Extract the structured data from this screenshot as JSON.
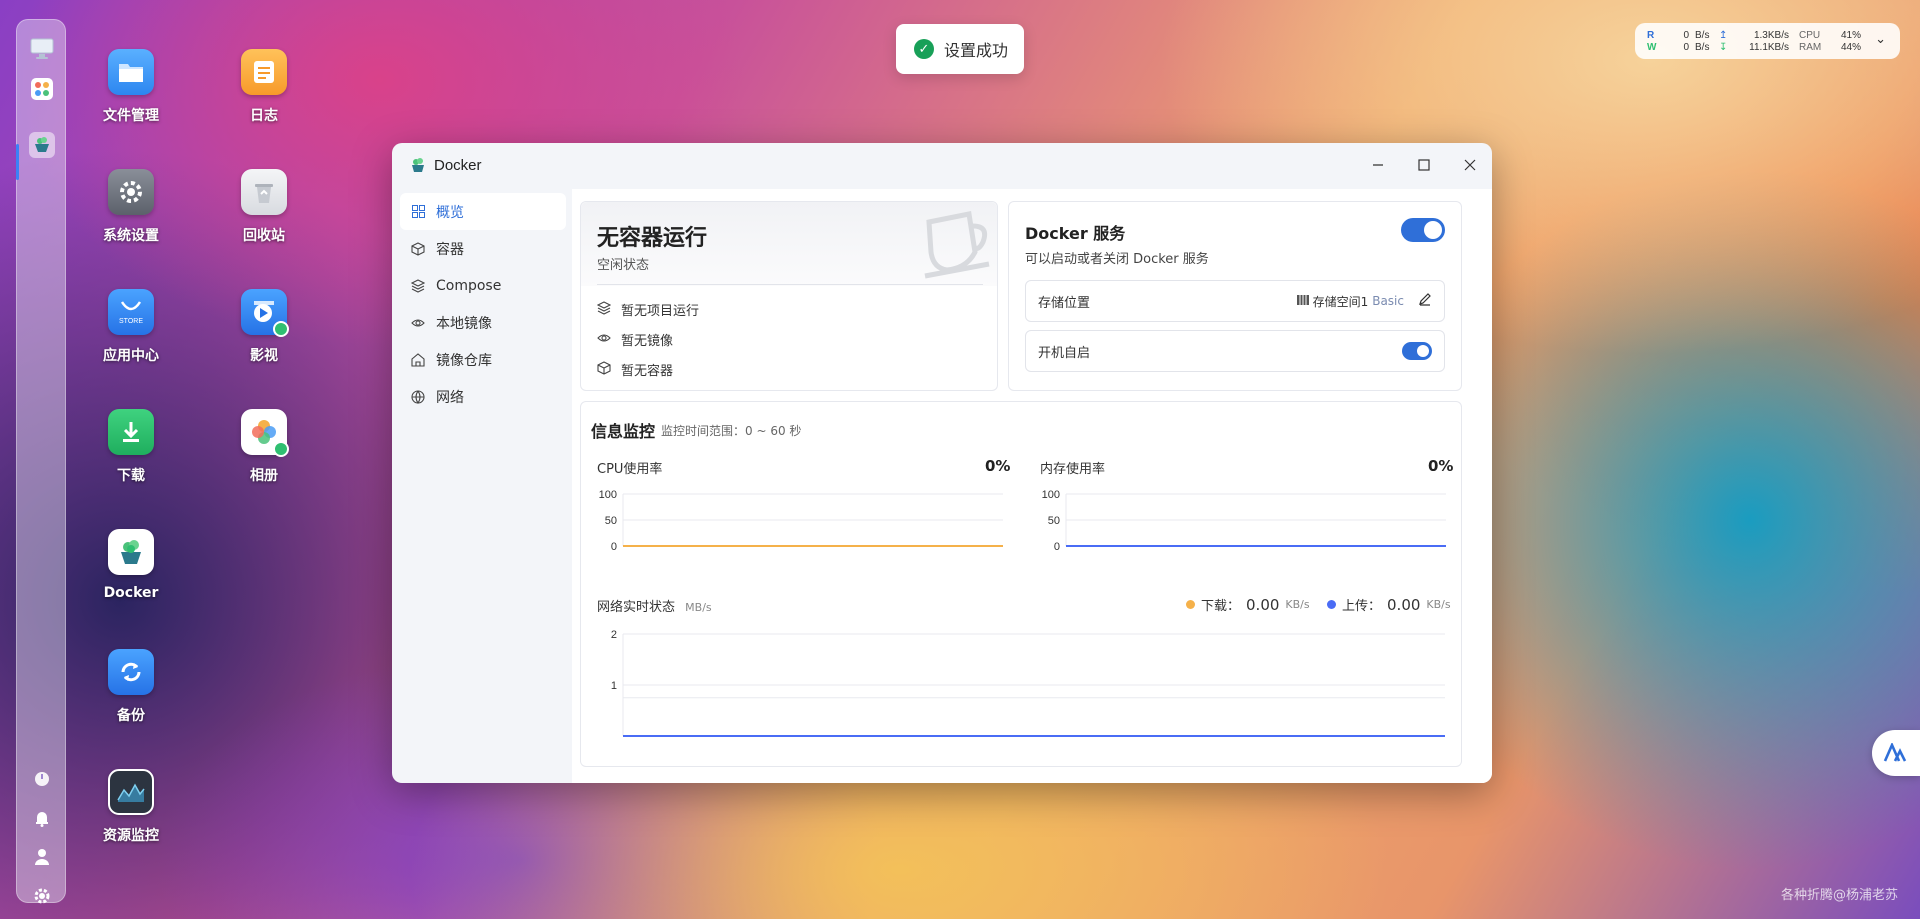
{
  "toast": {
    "text": "设置成功"
  },
  "net_widget": {
    "read_label": "R",
    "write_label": "W",
    "read_value": "0",
    "write_value": "0",
    "read_unit": "B/s",
    "write_unit": "B/s",
    "upload_speed": "1.3KB/s",
    "download_speed": "11.1KB/s",
    "cpu_label": "CPU",
    "ram_label": "RAM",
    "cpu_value": "41%",
    "ram_value": "44%"
  },
  "desktop_icons": [
    {
      "label": "文件管理"
    },
    {
      "label": "日志"
    },
    {
      "label": "系统设置"
    },
    {
      "label": "回收站"
    },
    {
      "label": "应用中心"
    },
    {
      "label": "影视"
    },
    {
      "label": "下载"
    },
    {
      "label": "相册"
    },
    {
      "label": "Docker"
    },
    {
      "label": "备份"
    },
    {
      "label": "资源监控"
    }
  ],
  "store_badge": "STORE",
  "window": {
    "title": "Docker",
    "nav": [
      {
        "label": "概览",
        "icon": "grid-icon",
        "active": true
      },
      {
        "label": "容器",
        "icon": "cube-icon"
      },
      {
        "label": "Compose",
        "icon": "layers-icon"
      },
      {
        "label": "本地镜像",
        "icon": "eye-icon"
      },
      {
        "label": "镜像仓库",
        "icon": "house-icon"
      },
      {
        "label": "网络",
        "icon": "globe-icon"
      }
    ],
    "idle": {
      "title": "无容器运行",
      "subtitle": "空闲状态",
      "items": [
        "暂无项目运行",
        "暂无镜像",
        "暂无容器"
      ]
    },
    "service": {
      "title": "Docker 服务",
      "subtitle": "可以启动或者关闭 Docker 服务",
      "enabled": true,
      "storage_label": "存储位置",
      "storage_value": "存储空间1",
      "storage_tag": "Basic",
      "autostart_label": "开机自启",
      "autostart": true
    },
    "monitor": {
      "title": "信息监控",
      "range": "监控时间范围：0 ~ 60 秒",
      "cpu_label": "CPU使用率",
      "cpu_value": "0%",
      "mem_label": "内存使用率",
      "mem_value": "0%",
      "net_label": "网络实时状态",
      "net_unit": "MB/s",
      "download_label": "下载：",
      "download_value": "0.00",
      "upload_label": "上传：",
      "upload_value": "0.00",
      "speed_unit": "KB/s"
    }
  },
  "watermark": "各种折腾@杨浦老苏",
  "colors": {
    "accent": "#2f6fd8",
    "cpu_line": "#f5b14a",
    "mem_line": "#4a6cf5",
    "download": "#f5b14a",
    "upload": "#4a6cf5"
  },
  "chart_data": [
    {
      "type": "line",
      "title": "CPU使用率",
      "ylim": [
        0,
        100
      ],
      "yticks": [
        "100",
        "50",
        "0"
      ],
      "series": [
        {
          "values": [
            0,
            0
          ]
        }
      ]
    },
    {
      "type": "line",
      "title": "内存使用率",
      "ylim": [
        0,
        100
      ],
      "yticks": [
        "100",
        "50",
        "0"
      ],
      "series": [
        {
          "values": [
            0,
            0
          ]
        }
      ]
    },
    {
      "type": "line",
      "title": "网络实时状态",
      "ylabel": "MB/s",
      "ylim": [
        0,
        2
      ],
      "yticks": [
        "2",
        "1"
      ],
      "series": [
        {
          "name": "下载",
          "values": [
            0,
            0
          ]
        },
        {
          "name": "上传",
          "values": [
            0,
            0
          ]
        }
      ]
    }
  ]
}
